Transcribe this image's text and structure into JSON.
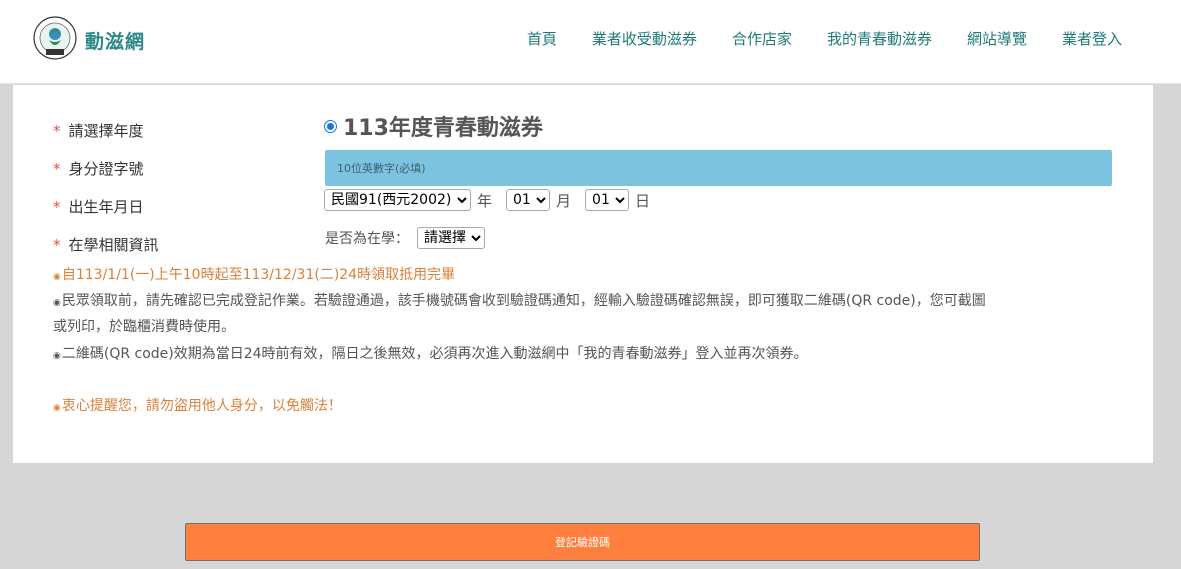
{
  "header": {
    "brand": "動滋網",
    "logo_icon": "ministry-of-education-seal-icon",
    "nav": [
      "首頁",
      "業者收受動滋券",
      "合作店家",
      "我的青春動滋券",
      "網站導覽",
      "業者登入"
    ]
  },
  "form": {
    "labels": {
      "year": "請選擇年度",
      "id": "身分證字號",
      "dob": "出生年月日",
      "school": "在學相關資訊"
    },
    "required_mark": "*",
    "year_option": "113年度青春動滋券",
    "id_placeholder": "10位英數字(必填)",
    "dob": {
      "year_value": "民國91(西元2002)",
      "year_unit": "年",
      "month_value": "01",
      "month_unit": "月",
      "day_value": "01",
      "day_unit": "日"
    },
    "school": {
      "question": "是否為在學：",
      "select_value": "請選擇"
    }
  },
  "notes": {
    "bullet": "◉",
    "line1": "自113/1/1(一)上午10時起至113/12/31(二)24時領取抵用完畢",
    "line2a": "民眾領取前，請先確認已完成登記作業。若驗證通過，該手機號碼會收到驗證碼通知，經輸入驗證碼確認無誤，即可獲取二維碼(QR code)，您可截圖",
    "line2b": "或列印，於臨櫃消費時使用。",
    "line3": "二維碼(QR code)效期為當日24時前有效，隔日之後無效，必須再次進入動滋網中「我的青春動滋券」登入並再次領券。",
    "warning": "衷心提醒您，請勿盜用他人身分，以免觸法！"
  },
  "submit_label": "登記驗證碼",
  "colors": {
    "brand": "#2e8a8a",
    "nav": "#1f7a7a",
    "input_bg": "#7dc3df",
    "orange_text": "#d9823b",
    "button": "#ff7f3f",
    "required": "#d9534f"
  }
}
